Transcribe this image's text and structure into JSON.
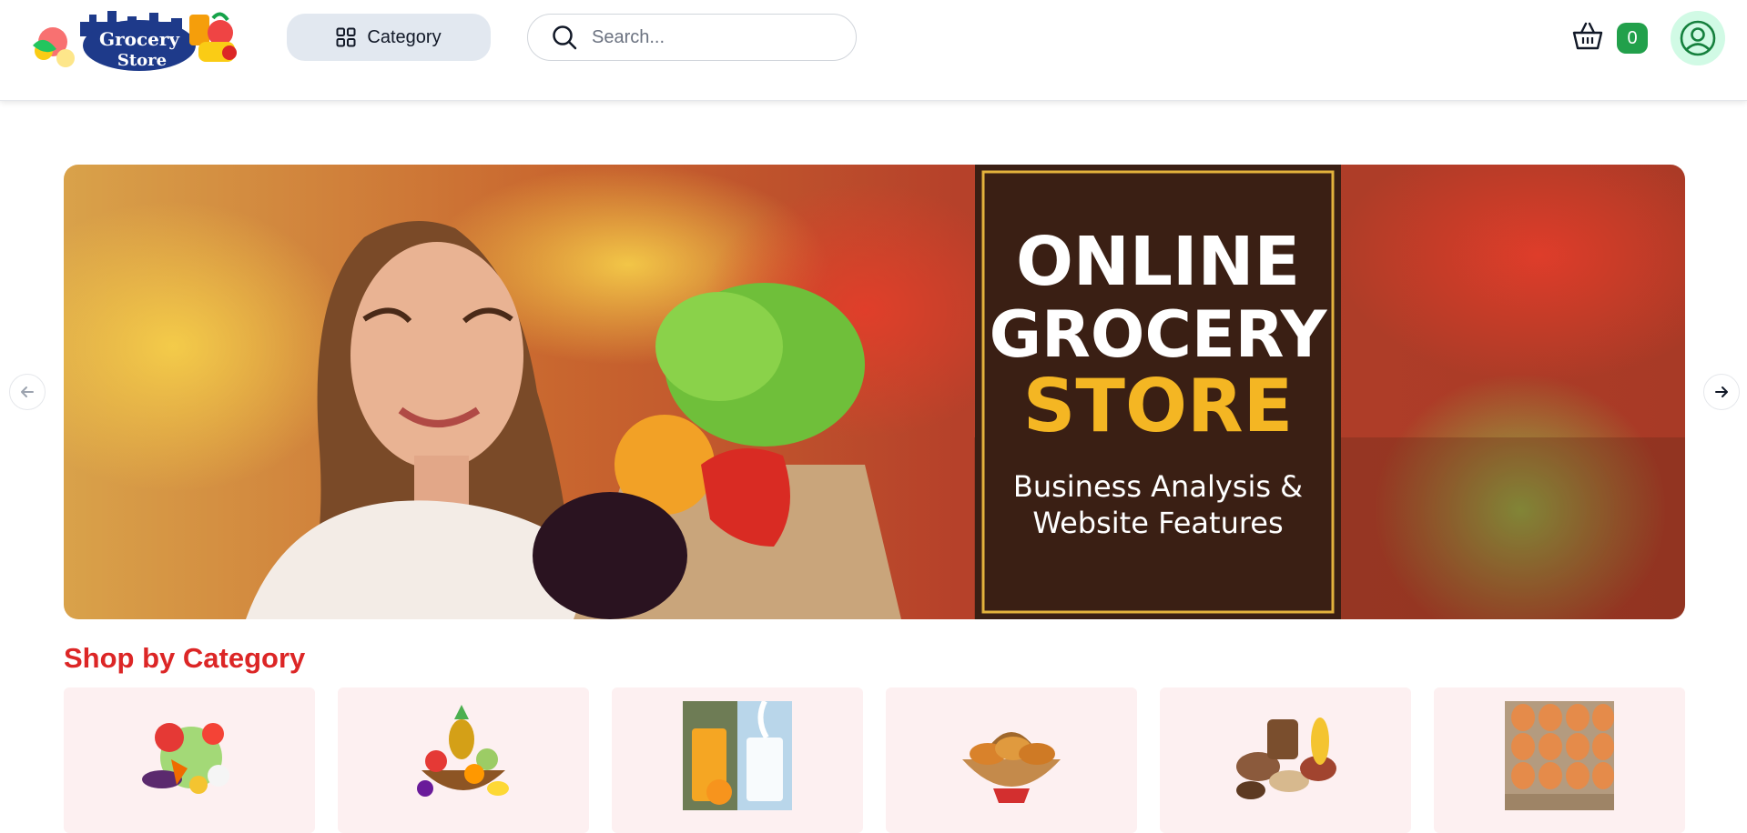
{
  "header": {
    "logo": {
      "line1": "Grocery",
      "line2": "Store"
    },
    "category_label": "Category",
    "search": {
      "placeholder": "Search...",
      "value": ""
    },
    "cart_count": "0",
    "icons": [
      "grid-icon",
      "search-icon",
      "basket-icon",
      "user-icon"
    ]
  },
  "banner": {
    "line1": "ONLINE",
    "line2": "GROCERY",
    "line3": "STORE",
    "subline1": "Business Analysis &",
    "subline2": "Website Features"
  },
  "section": {
    "title": "Shop by Category"
  },
  "categories": [
    {
      "image": "vegetables-image"
    },
    {
      "image": "fruit-basket-image"
    },
    {
      "image": "juice-milk-image"
    },
    {
      "image": "bread-basket-image"
    },
    {
      "image": "grains-image"
    },
    {
      "image": "eggs-image"
    }
  ],
  "colors": {
    "accent": "#dc2626",
    "badge": "#22a04b",
    "category_bg": "#e2e8f0",
    "card_bg": "#fdf0f1"
  }
}
